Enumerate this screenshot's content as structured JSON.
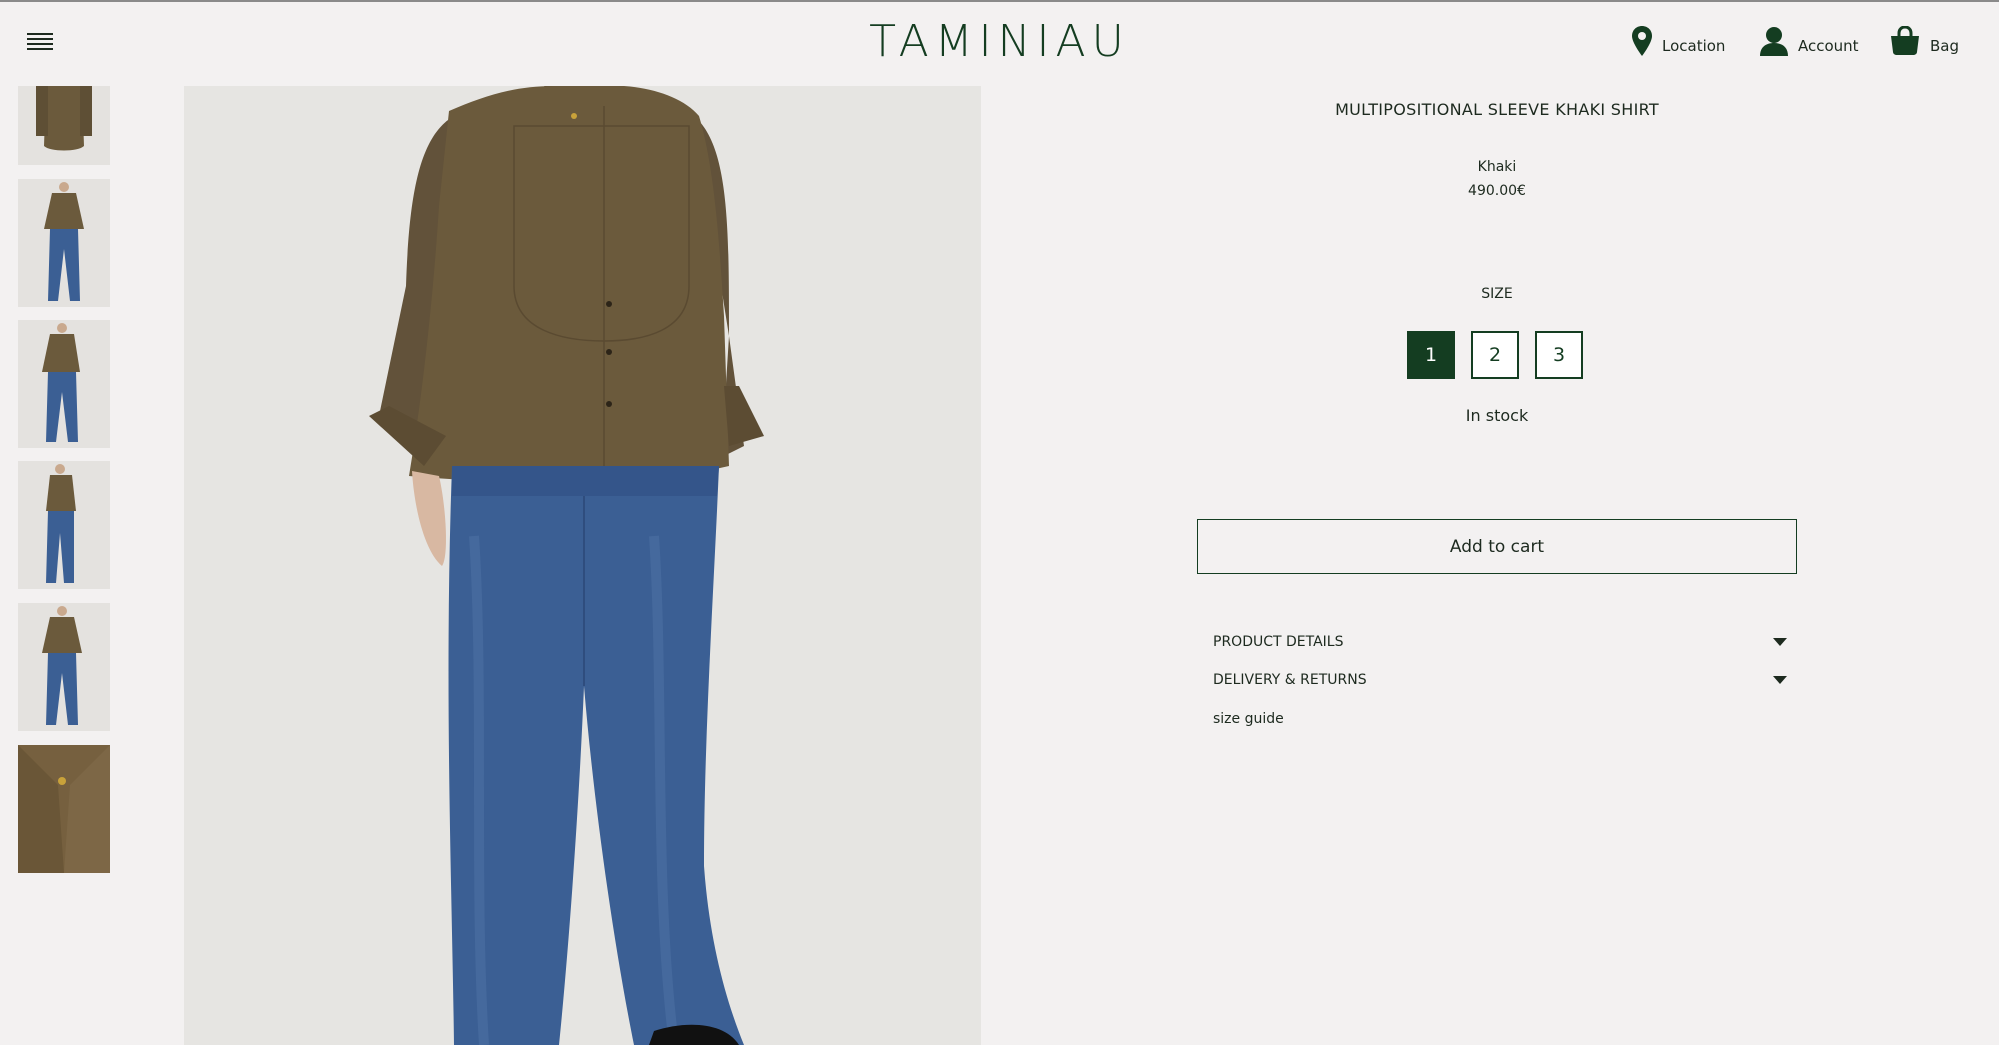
{
  "header": {
    "logo": "TAMINIAU",
    "nav": {
      "location": "Location",
      "account": "Account",
      "bag": "Bag"
    }
  },
  "product": {
    "title": "MULTIPOSITIONAL SLEEVE KHAKI SHIRT",
    "color": "Khaki",
    "price": "490.00€",
    "size_label": "SIZE",
    "sizes": [
      "1",
      "2",
      "3"
    ],
    "selected_size": "1",
    "stock": "In stock",
    "add_to_cart": "Add to cart",
    "accordion": {
      "details": "PRODUCT DETAILS",
      "delivery": "DELIVERY & RETURNS"
    },
    "size_guide": "size guide"
  },
  "colors": {
    "brand_green": "#143d21",
    "background": "#f3f1f1",
    "shirt_khaki": "#6b5a3c",
    "denim": "#3b5f94"
  },
  "icons": [
    "menu-icon",
    "location-pin-icon",
    "account-icon",
    "bag-icon",
    "chevron-down-icon"
  ]
}
